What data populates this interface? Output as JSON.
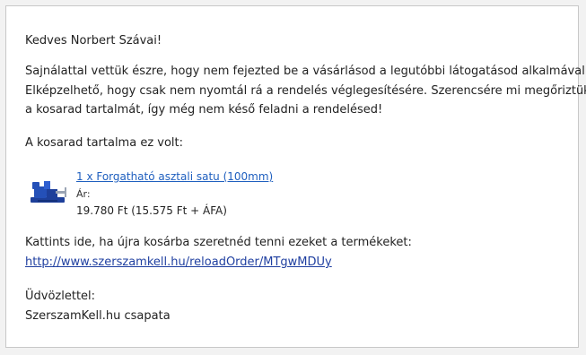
{
  "email": {
    "greeting": "Kedves Norbert Szávai!",
    "paragraph_lines": [
      "Sajnálattal vettük észre, hogy nem fejezted be a vásárlásod a legutóbbi látogatásod alkalmával.",
      "Elképzelhető, hogy csak nem nyomtál rá a rendelés véglegesítésére. Szerencsére mi megőriztük",
      "a kosarad tartalmát, így még nem késő feladni a rendelésed!"
    ],
    "cart_intro": "A kosarad tartalma ez volt:",
    "product": {
      "image_icon": "bench-vise-icon",
      "title": "1 x Forgatható asztali satu (100mm)",
      "price_label": "Ár:",
      "price": "19.780 Ft (15.575 Ft + ÁFA)"
    },
    "reload_text": "Kattints ide, ha újra kosárba szeretnéd tenni ezeket a termékeket:",
    "reload_url": "http://www.szerszamkell.hu/reloadOrder/MTgwMDUy",
    "signoff_line1": "Üdvözlettel:",
    "signoff_line2": "SzerszamKell.hu csapata"
  },
  "colors": {
    "link": "#1f5fbf",
    "vise_blue": "#1d3f9a"
  }
}
